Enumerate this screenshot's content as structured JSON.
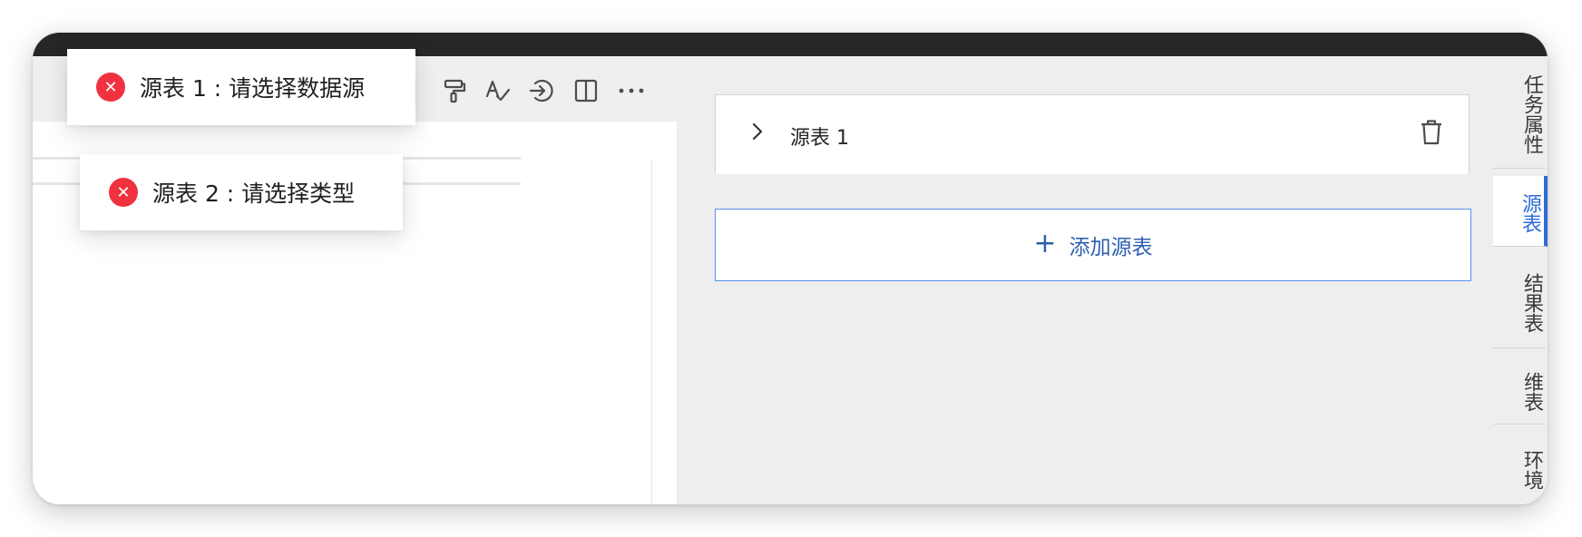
{
  "toasts": [
    {
      "message": "源表 1 : 请选择数据源",
      "icon": "error-circle-icon",
      "color": "#f0313f"
    },
    {
      "message": "源表 2 : 请选择类型",
      "icon": "error-circle-icon",
      "color": "#f0313f"
    }
  ],
  "toolbar": {
    "icons": [
      "format-painter-icon",
      "spell-check-icon",
      "import-icon",
      "split-view-icon",
      "more-icon"
    ]
  },
  "panel": {
    "source_cards": [
      {
        "title": "源表 1"
      }
    ],
    "add_source_label": "添加源表",
    "add_icon": "+"
  },
  "side_tabs": [
    {
      "label": "任务属性",
      "active": false
    },
    {
      "label": "源表",
      "active": true
    },
    {
      "label": "结果表",
      "active": false
    },
    {
      "label": "维表",
      "active": false
    },
    {
      "label": "环境",
      "active": false
    }
  ],
  "colors": {
    "accent": "#2f6bd6",
    "error": "#f0313f",
    "titlebar": "#262626"
  }
}
